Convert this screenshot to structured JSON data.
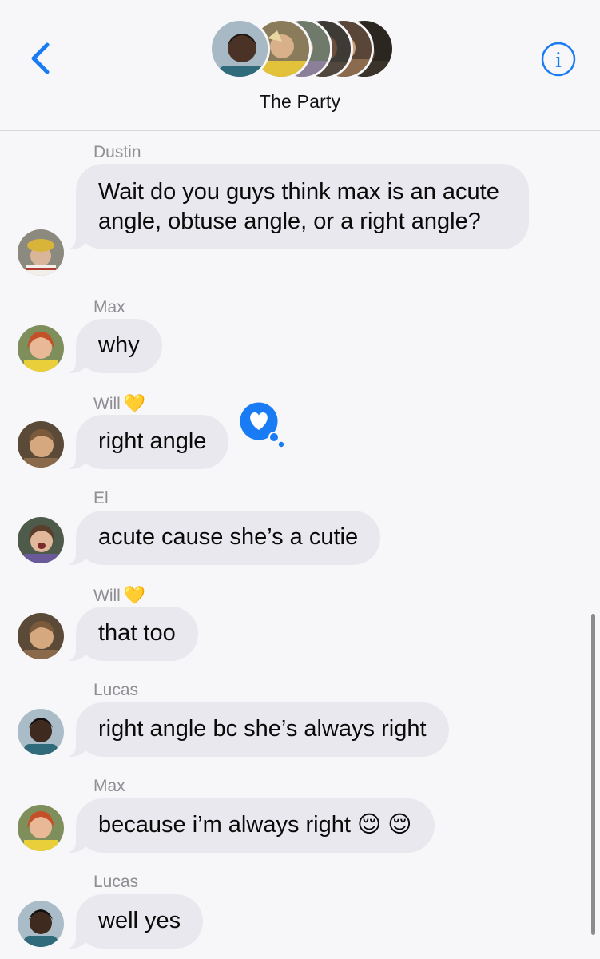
{
  "header": {
    "title": "The Party",
    "back_icon": "chevron-left-icon",
    "info_icon": "info-circle-icon",
    "accent_color": "#1a7cf5"
  },
  "messages": [
    {
      "sender": "Dustin",
      "text": "Wait do you guys think max is an acute angle, obtuse angle, or a right angle?",
      "heart": false
    },
    {
      "sender": "Max",
      "text": "why",
      "heart": false
    },
    {
      "sender": "Will",
      "text": "right angle",
      "heart": true,
      "tapback": "heart-icon"
    },
    {
      "sender": "El",
      "text": "acute cause she’s a cutie",
      "heart": false
    },
    {
      "sender": "Will",
      "text": "that too",
      "heart": true
    },
    {
      "sender": "Lucas",
      "text": "right angle bc she’s always right",
      "heart": false
    },
    {
      "sender": "Max",
      "text": "because i’m always right 😌 😌",
      "heart": false
    },
    {
      "sender": "Lucas",
      "text": "well yes",
      "heart": false
    }
  ],
  "sender_heart_emoji": "💛",
  "colors": {
    "bubble": "#e9e8ee",
    "background": "#f7f7f9",
    "sender_text": "#8e8e93",
    "tapback": "#1a7cf5"
  }
}
